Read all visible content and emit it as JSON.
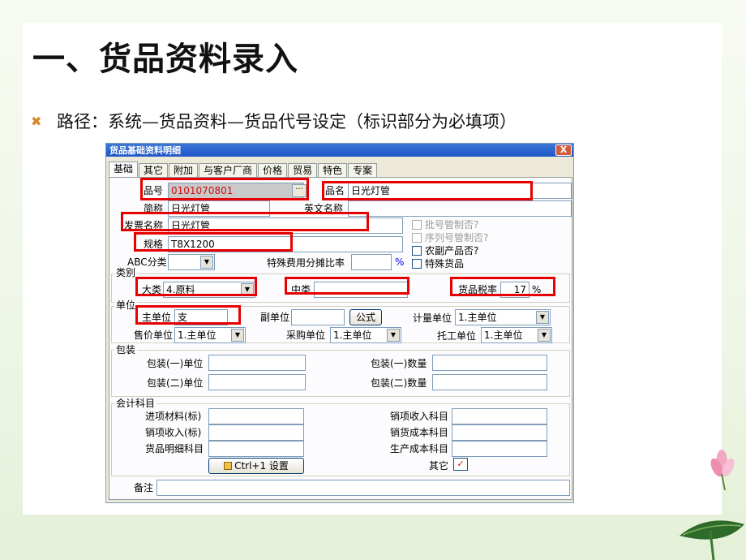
{
  "slide": {
    "title": "一、货品资料录入",
    "bullet": "路径：系统—货品资料—货品代号设定（标识部分为必填项）",
    "bullet_icon": "x-mark-icon"
  },
  "dialog": {
    "title": "货品基础资料明细",
    "close_label": "X",
    "tabs": [
      "基础",
      "其它",
      "附加",
      "与客户厂商",
      "价格",
      "贸易",
      "特色",
      "专案"
    ],
    "fields": {
      "item_no_label": "品号",
      "item_no_value": "0101070801",
      "item_name_label": "品名",
      "item_name_value": "日光灯管",
      "short_name_label": "简称",
      "short_name_value": "日光灯管",
      "english_name_label": "英文名称",
      "english_name_value": "",
      "invoice_name_label": "发票名称",
      "invoice_name_value": "日光灯管",
      "spec_label": "规格",
      "spec_value": "T8X1200",
      "abc_label": "ABC分类",
      "abc_value": "",
      "special_fee_label": "特殊费用分摊比率",
      "special_fee_value": "",
      "special_fee_unit": "%"
    },
    "checkboxes": {
      "batch_label": "批号管制否?",
      "serial_label": "序列号管制否?",
      "agri_label": "农副产品否?",
      "special_item_label": "特殊货品"
    },
    "category": {
      "group_label": "类别",
      "major_label": "大类",
      "major_value": "4.原料",
      "mid_label": "中类",
      "mid_value": "",
      "tax_label": "货品税率",
      "tax_value": "17",
      "tax_unit": "%"
    },
    "unit": {
      "group_label": "单位",
      "main_label": "主单位",
      "main_value": "支",
      "sub_label": "副单位",
      "sub_value": "",
      "formula_button": "公式",
      "calc_label": "计量单位",
      "calc_value": "1.主单位",
      "sale_label": "售价单位",
      "sale_value": "1.主单位",
      "purchase_label": "采购单位",
      "purchase_value": "1.主单位",
      "outsource_label": "托工单位",
      "outsource_value": "1.主单位"
    },
    "package": {
      "group_label": "包装",
      "pack1_unit_label": "包装(一)单位",
      "pack2_unit_label": "包装(二)单位",
      "pack1_qty_label": "包装(一)数量",
      "pack2_qty_label": "包装(二)数量"
    },
    "accounting": {
      "group_label": "会计科目",
      "in_material_label": "进项材料(标)",
      "sales_income_std_label": "销项收入(标)",
      "item_detail_label": "货品明细科目",
      "sales_income_label": "销项收入科目",
      "sales_cost_label": "销货成本科目",
      "production_cost_label": "生产成本科目",
      "other_label": "其它",
      "other_checked_mark": "✓",
      "settings_button": "Ctrl+1 设置"
    },
    "remark_label": "备注",
    "combo_arrow": "▼",
    "ellipsis": "···"
  },
  "colors": {
    "highlight": "#e60000",
    "title_bar": "#1f55c4",
    "dialog_bg": "#ece9d8",
    "bullet": "#d6892a"
  }
}
